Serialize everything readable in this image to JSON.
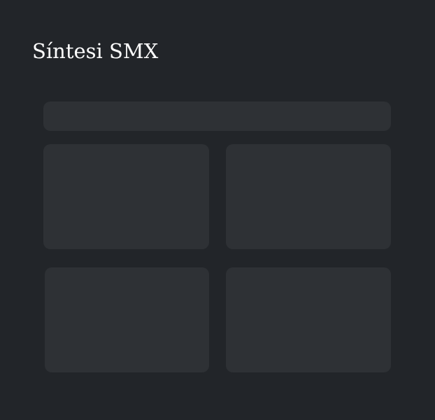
{
  "header": {
    "title": "Síntesi SMX"
  },
  "colors": {
    "background": "#222529",
    "panel": "#2e3135",
    "title_text": "#ffffff"
  },
  "content": {
    "top_bar": {
      "state": "empty-placeholder"
    },
    "cards": [
      {
        "state": "empty-placeholder"
      },
      {
        "state": "empty-placeholder"
      },
      {
        "state": "empty-placeholder"
      },
      {
        "state": "empty-placeholder"
      }
    ]
  }
}
